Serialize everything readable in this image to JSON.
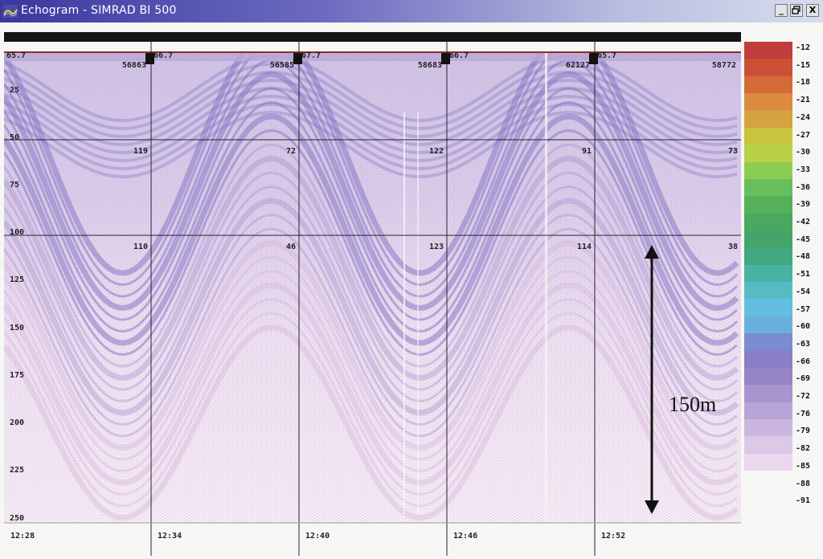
{
  "window": {
    "title": "Echogram - SIMRAD BI 500",
    "controls": {
      "minimize": "_",
      "restore": "̅",
      "close": "X"
    }
  },
  "echogram": {
    "depth_labels": [
      "25",
      "50",
      "75",
      "100",
      "125",
      "150",
      "175",
      "200",
      "225",
      "250"
    ],
    "time_labels": [
      "12:28",
      "12:34",
      "12:40",
      "12:46",
      "12:52"
    ],
    "ping_labels": [
      "56863",
      "56585",
      "58683",
      "62127",
      "58772"
    ],
    "top_values": [
      "65.7",
      "66.7",
      "67.7",
      "66.7",
      "65.7"
    ],
    "row1_counts": [
      "119",
      "72",
      "122",
      "91",
      "73"
    ],
    "row2_counts": [
      "110",
      "46",
      "123",
      "114",
      "38"
    ],
    "annotation": "150m"
  },
  "color_scale": {
    "labels": [
      "-12",
      "-15",
      "-18",
      "-21",
      "-24",
      "-27",
      "-30",
      "-33",
      "-36",
      "-39",
      "-42",
      "-45",
      "-48",
      "-51",
      "-54",
      "-57",
      "-60",
      "-63",
      "-66",
      "-69",
      "-72",
      "-76",
      "-79",
      "-82",
      "-85",
      "-88",
      "-91"
    ],
    "colors": [
      "#c13c3a",
      "#cc4f37",
      "#d56a39",
      "#dd8a40",
      "#d5a33f",
      "#c9c43e",
      "#b8d046",
      "#8ccc52",
      "#66bf5a",
      "#55b05a",
      "#4aa860",
      "#43a569",
      "#41a882",
      "#48b3a2",
      "#57bcc2",
      "#63bddf",
      "#6aaee0",
      "#7a8cd0",
      "#8a7fc7",
      "#9585c6",
      "#a894ce",
      "#b8a3d6",
      "#cbb6df",
      "#dcc8e7",
      "#ebd7ee"
    ]
  }
}
